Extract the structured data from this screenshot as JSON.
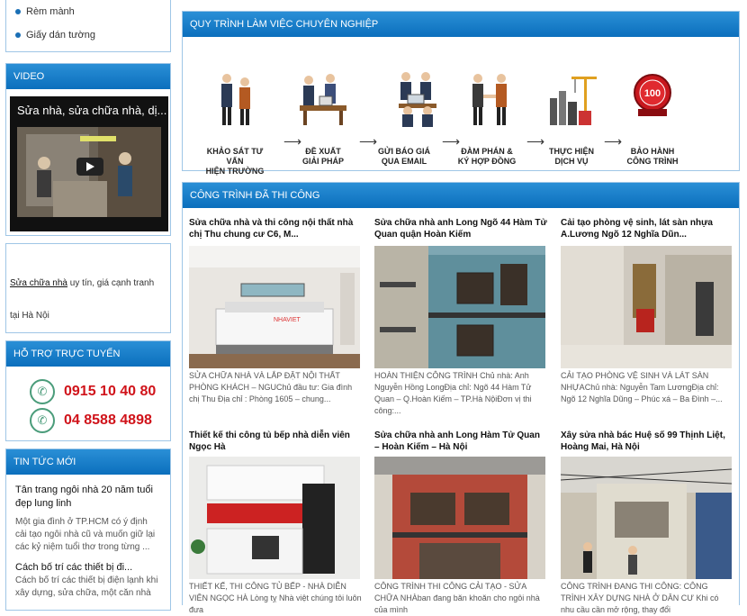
{
  "sidebar": {
    "categories": [
      {
        "label": "Rèm mành"
      },
      {
        "label": "Giấy dán tường"
      }
    ],
    "video": {
      "header": "VIDEO",
      "title": "Sửa nhà, sửa chữa nhà, dị..."
    },
    "promo": {
      "link_text": "Sửa chữa nhà",
      "text_after": " uy tín, giá cạnh tranh",
      "location": "tại Hà Nội"
    },
    "support": {
      "header": "HỖ TRỢ TRỰC TUYẾN",
      "phones": [
        "0915 10 40 80",
        "04 8588 4898"
      ]
    },
    "news": {
      "header": "TIN TỨC MỚI",
      "items": [
        {
          "title": "Tân trang ngôi nhà 20 năm tuổi đẹp lung linh",
          "desc": "Một gia đình ở TP.HCM có ý định cải tạo ngôi nhà cũ và muốn giữ lại các kỷ niệm tuổi thơ trong từng ..."
        },
        {
          "title": "Cách bố trí các thiết bị đi...",
          "desc": "Cách bố trí các thiết bị điện lạnh khi xây dựng, sửa chữa, một căn nhà"
        }
      ]
    }
  },
  "process": {
    "header": "QUY TRÌNH LÀM VIỆC CHUYÊN NGHIỆP",
    "steps": [
      {
        "line1": "KHẢO SÁT TƯ VẤN",
        "line2": "HIỆN TRƯỜNG"
      },
      {
        "line1": "ĐỀ XUẤT",
        "line2": "GIẢI PHÁP"
      },
      {
        "line1": "GỬI BÁO GIÁ",
        "line2": "QUA EMAIL"
      },
      {
        "line1": "ĐÀM PHÁN &",
        "line2": "KÝ HỢP ĐỒNG"
      },
      {
        "line1": "THỰC HIỆN",
        "line2": "DỊCH VỤ"
      },
      {
        "line1": "BẢO HÀNH",
        "line2": "CÔNG TRÌNH"
      }
    ],
    "badge": "100"
  },
  "projects": {
    "header": "CÔNG TRÌNH ĐÃ THI CÔNG",
    "watermark": "NHAVIET",
    "items": [
      {
        "title": "Sửa chữa nhà và thi công nội thất nhà chị Thu chung cư C6, M...",
        "desc": "SỬA CHỮA NHÀ VÀ LẮP ĐẶT NỘI THẤT PHÒNG KHÁCH – NGUChủ đầu tư: Gia đình chị Thu Địa chỉ : Phòng 1605 – chung..."
      },
      {
        "title": "Sửa chữa nhà anh Long Ngõ 44 Hàm Tử Quan quận Hoàn Kiếm",
        "desc": "HOÀN THIỆN CÔNG TRÌNH Chủ nhà: Anh Nguyễn Hồng LongĐịa chỉ: Ngõ 44 Hàm Tử Quan – Q.Hoàn Kiếm – TP.Hà NộiĐơn vị thi công:..."
      },
      {
        "title": "Cải tạo phòng vệ sinh, lát sàn nhựa A.Lương Ngõ 12 Nghĩa Dũn...",
        "desc": "CẢI TẠO PHÒNG VỆ SINH VÀ LÁT SÀN NHỰAChủ nhà: Nguyễn Tam LươngĐịa chỉ: Ngõ 12 Nghĩa Dũng – Phúc xá – Ba Đình –..."
      },
      {
        "title": "Thiết kế thi công tủ bếp nhà diễn viên Ngọc Hà",
        "desc": "THIẾT KẾ, THI CÔNG TỦ BẾP - NHÀ DIỄN VIÊN NGỌC HÀ Lòng tỵ Nhà việt chúng tôi luôn đưa"
      },
      {
        "title": "Sửa chữa nhà anh Long Hàm Tử Quan – Hoàn Kiếm – Hà Nội",
        "desc": "CÔNG TRÌNH THI CÔNG CẢI TẠO - SỬA CHỮA NHÀban đang băn khoăn cho ngôi nhà của mình"
      },
      {
        "title": "Xây sửa nhà bác Huệ số 99 Thịnh Liệt, Hoàng Mai, Hà Nội",
        "desc": "CÔNG TRÌNH ĐANG THI CÔNG: CÔNG TRÌNH XÂY DỰNG NHÀ Ở DÂN CƯ Khi có nhu cầu cần mở rộng, thay đổi"
      }
    ]
  }
}
